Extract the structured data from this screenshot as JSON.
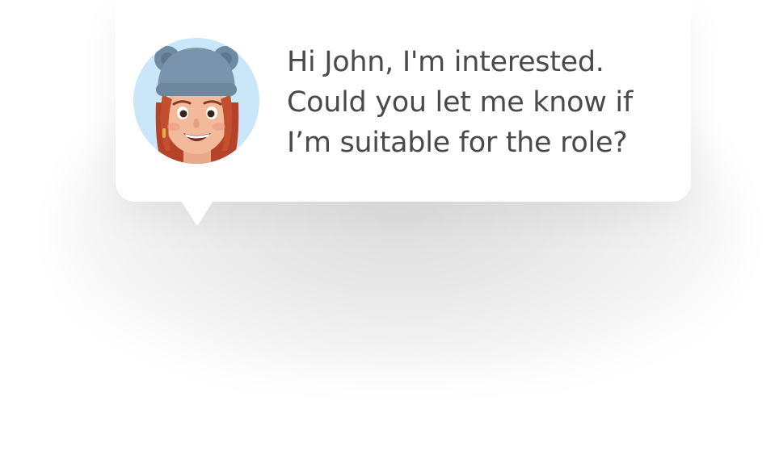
{
  "message": {
    "lines": [
      "Hi John, I'm interested.",
      "Could you let me know if",
      "I’m suitable for the role?"
    ]
  },
  "avatar": {
    "icon": "memoji-avatar-icon",
    "background_color": "#c9e7f8"
  },
  "colors": {
    "text": "#4a4a4a",
    "bubble": "#ffffff"
  }
}
